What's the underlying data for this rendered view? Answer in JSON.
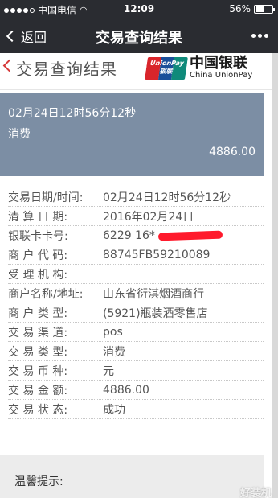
{
  "status_bar": {
    "carrier": "中国电信",
    "time": "12:09",
    "battery": "56%",
    "battery_level": 0.56
  },
  "nav": {
    "back_label": "返回",
    "title": "交易查询结果"
  },
  "page_header": {
    "title": "交易查询结果",
    "logo_mark_text": "UnionPay 银联",
    "logo_cn": "中国银联",
    "logo_en": "China UnionPay"
  },
  "summary": {
    "datetime": "02月24日12时56分12秒",
    "type": "消费",
    "amount": "4886.00"
  },
  "details": [
    {
      "label": "交易日期/时间:",
      "value": "02月24日12时56分12秒"
    },
    {
      "label": "清 算 日 期:",
      "value": "2016年02月24日"
    },
    {
      "label": "银联卡卡号:",
      "value": "6229 16*"
    },
    {
      "label": "商 户 代 码:",
      "value": "88745FB59210089"
    },
    {
      "label": "受 理 机 构:",
      "value": ""
    },
    {
      "label": "商户名称/地址:",
      "value": "山东省衍淇烟酒商行"
    },
    {
      "label": "商 户 类 型:",
      "value": "(5921)瓶装酒零售店"
    },
    {
      "label": "交 易 渠 道:",
      "value": "pos"
    },
    {
      "label": "交 易 类 型:",
      "value": "消费"
    },
    {
      "label": "交 易 币 种:",
      "value": "元"
    },
    {
      "label": "交 易 金 额:",
      "value": "4886.00"
    },
    {
      "label": "交 易 状 态:",
      "value": "成功"
    }
  ],
  "notice": {
    "title": "温馨提示:"
  },
  "watermark": "好装机"
}
